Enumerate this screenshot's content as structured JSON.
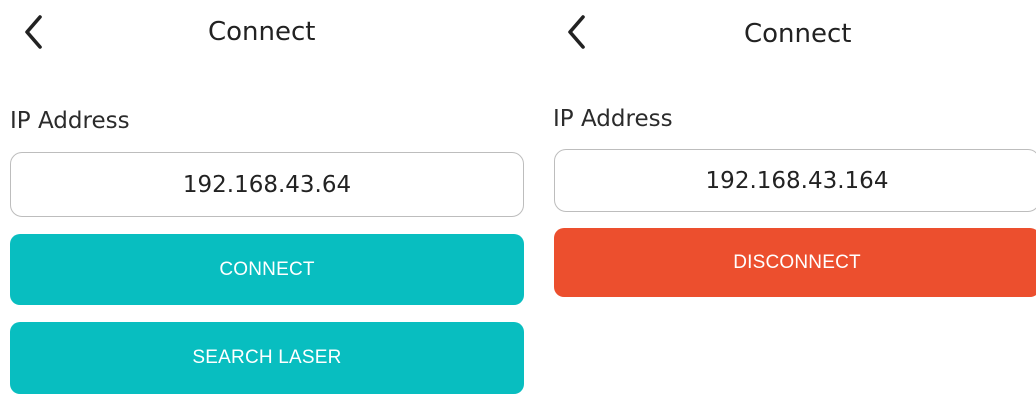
{
  "screens": [
    {
      "title": "Connect",
      "ip_label": "IP Address",
      "ip_value": "192.168.43.64",
      "buttons": {
        "connect": "CONNECT",
        "search_laser": "SEARCH LASER"
      }
    },
    {
      "title": "Connect",
      "ip_label": "IP Address",
      "ip_value": "192.168.43.164",
      "buttons": {
        "disconnect": "DISCONNECT"
      }
    }
  ],
  "icons": {
    "back": "chevron-left-icon"
  },
  "colors": {
    "connect_button": "#08BEC0",
    "disconnect_button": "#EC4F2E",
    "button_text": "#FFFFFF",
    "field_border": "#BDBDBD"
  }
}
